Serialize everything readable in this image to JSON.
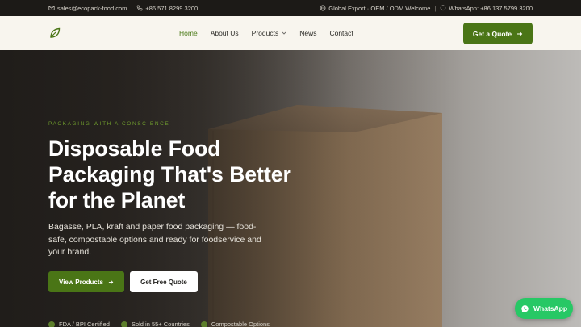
{
  "topbar": {
    "email": "sales@ecopack-food.com",
    "separator": "|",
    "phone": "+86 571 8299 3200",
    "export_note": "Global Export · OEM / ODM Welcome",
    "separator2": "|",
    "whatsapp": "WhatsApp: +86 137 5799 3200"
  },
  "header": {
    "nav": [
      {
        "label": "Home",
        "active": true
      },
      {
        "label": "About Us"
      },
      {
        "label": "Products",
        "has_dropdown": true
      },
      {
        "label": "News"
      },
      {
        "label": "Contact"
      }
    ],
    "cta": "Get a Quote"
  },
  "hero": {
    "eyebrow": "Packaging with a conscience",
    "headline_lines": [
      "Disposable Food",
      "Packaging That's Better",
      "for the Planet"
    ],
    "lead": "Bagasse, PLA, kraft and paper food packaging — food-safe, compostable options and ready for foodservice and your brand.",
    "primary_button": "View Products",
    "secondary_button": "Get Free Quote",
    "badges": [
      "FDA / BPI Certified",
      "Sold in 55+ Countries",
      "Compostable Options"
    ]
  },
  "floating": {
    "whatsapp_label": "WhatsApp"
  },
  "colors": {
    "brand_green": "#4a7516",
    "eyebrow_green": "#6e9a2d",
    "whatsapp_green": "#27c865",
    "topbar_bg": "#1c1a17",
    "header_bg": "#f8f5ee"
  },
  "icons": {
    "email": "mail-icon",
    "phone": "phone-icon",
    "globe": "globe-icon",
    "whatsapp": "whatsapp-icon",
    "logo": "leaf-icon",
    "arrow": "arrow-right-icon",
    "dropdown": "chevron-down-icon"
  }
}
